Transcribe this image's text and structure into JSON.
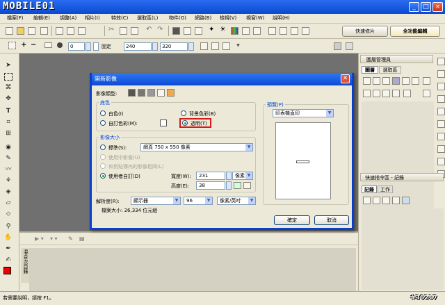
{
  "app": {
    "logo": "MOBILE01",
    "watermark": "#36217"
  },
  "menubar": [
    "檔案(F)",
    "編輯(E)",
    "調整(A)",
    "相片(I)",
    "特效(C)",
    "選取區(L)",
    "物件(O)",
    "網路(B)",
    "檢視(V)",
    "視窗(W)",
    "說明(H)"
  ],
  "modes": {
    "quick": "快速修片",
    "full": "全功能編輯"
  },
  "toolbar2": {
    "width": "240",
    "height": "320",
    "fixed_label": "固定",
    "value_zero": "0",
    "plus": "+",
    "minus": "−"
  },
  "right_panel": {
    "layers_title": "圖層管理員",
    "layers_tab": "圖層",
    "selection_tab": "選取區",
    "history_title": "快速指令區 - 記錄",
    "history_tab": "記錄",
    "work_tab": "工作"
  },
  "bottom_panel": {
    "vertical_label": "混合次目錄"
  },
  "status": {
    "help_text": "若需要說明，請按 F1。"
  },
  "dialog": {
    "title": "開新影像",
    "image_type_label": "影像類型:",
    "bg_group": "底色",
    "bg_white": "白色(I)",
    "bg_custom": "自訂色彩(M):",
    "bg_bgcolor": "背景色彩(B)",
    "bg_transparent": "透明(T)",
    "size_group": "影像大小",
    "std_label": "標準(S):",
    "std_value": "網頁 750 x 550 像素",
    "use_clipboard": "使用中影像(U)",
    "same_as_clip": "和剪貼簿內的影像相同(L)",
    "custom_label": "使用者自訂(D)",
    "width_label": "寬度(W):",
    "width_value": "231",
    "height_label": "高度(E):",
    "height_value": "38",
    "unit_value": "像素",
    "resolution_label": "解析度(R):",
    "resolution_source": "顯示器",
    "resolution_value": "96",
    "resolution_unit": "像素/英吋",
    "filesize": "檔案大小: 26,334 位元組",
    "preview_group": "預覽(P)",
    "preview_combo": "印表機直印",
    "ok": "確定",
    "cancel": "取消"
  }
}
